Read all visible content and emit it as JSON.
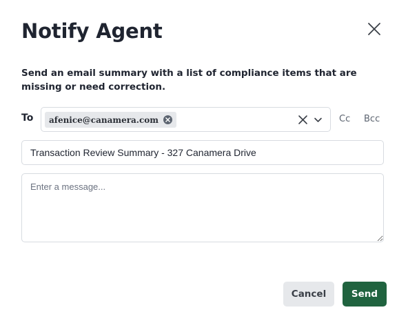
{
  "dialog": {
    "title": "Notify Agent",
    "description": "Send an email summary with a list of compliance items that are missing or need correction."
  },
  "recipients": {
    "to_label": "To",
    "chips": [
      "afenice@canamera.com"
    ],
    "cc_label": "Cc",
    "bcc_label": "Bcc"
  },
  "subject": {
    "value": "Transaction Review Summary - 327 Canamera Drive"
  },
  "message": {
    "value": "",
    "placeholder": "Enter a message..."
  },
  "actions": {
    "cancel_label": "Cancel",
    "send_label": "Send"
  },
  "colors": {
    "primary": "#20633f",
    "secondary_button": "#e6e8eb",
    "border": "#d7dbe0",
    "text": "#1f2430"
  },
  "icons": {
    "close": "close-icon",
    "chip_remove": "remove-circle-icon",
    "clear": "clear-icon",
    "dropdown": "chevron-down-icon"
  }
}
